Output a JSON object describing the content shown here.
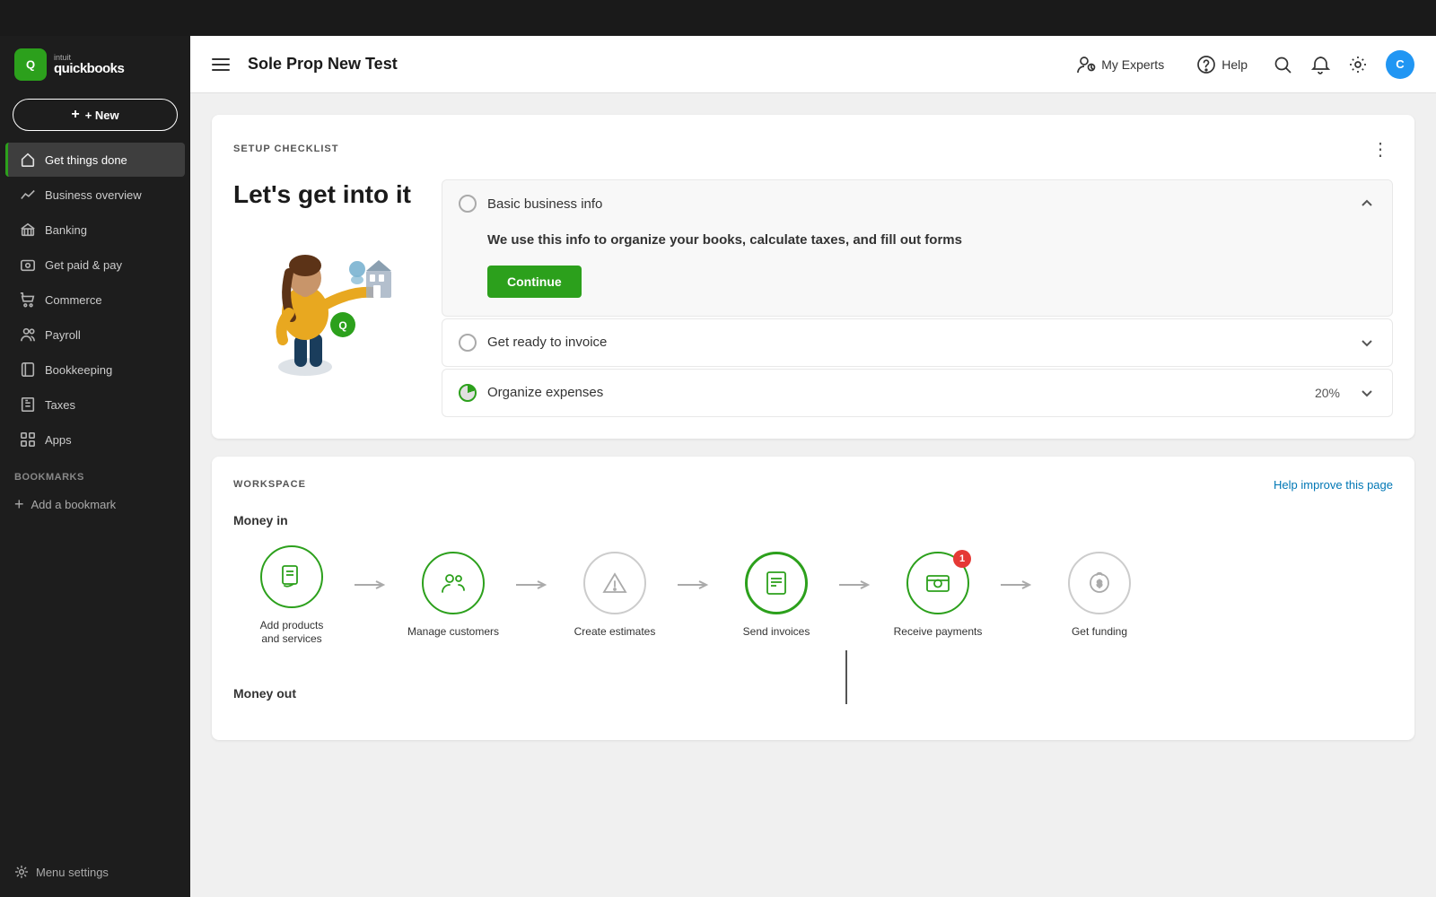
{
  "topBar": {
    "visible": true
  },
  "sidebar": {
    "logo": {
      "text1": "intuit",
      "text2": "quickbooks"
    },
    "newButton": {
      "label": "+ New"
    },
    "navItems": [
      {
        "id": "get-things-done",
        "label": "Get things done",
        "icon": "home",
        "active": true
      },
      {
        "id": "business-overview",
        "label": "Business overview",
        "icon": "chart"
      },
      {
        "id": "banking",
        "label": "Banking",
        "icon": "bank"
      },
      {
        "id": "get-paid-pay",
        "label": "Get paid & pay",
        "icon": "dollar"
      },
      {
        "id": "commerce",
        "label": "Commerce",
        "icon": "shop"
      },
      {
        "id": "payroll",
        "label": "Payroll",
        "icon": "people"
      },
      {
        "id": "bookkeeping",
        "label": "Bookkeeping",
        "icon": "book"
      },
      {
        "id": "taxes",
        "label": "Taxes",
        "icon": "tax"
      },
      {
        "id": "apps",
        "label": "Apps",
        "icon": "apps"
      }
    ],
    "bookmarks": {
      "label": "BOOKMARKS",
      "addLabel": "Add a bookmark"
    },
    "footer": {
      "menuSettingsLabel": "Menu settings"
    }
  },
  "header": {
    "title": "Sole Prop New Test",
    "myExpertsLabel": "My Experts",
    "helpLabel": "Help",
    "userInitial": "C"
  },
  "setupChecklist": {
    "sectionLabel": "SETUP CHECKLIST",
    "mainTitle": "Let's get into it",
    "items": [
      {
        "id": "basic-business-info",
        "label": "Basic business info",
        "expanded": true,
        "description": "We use this info to organize your books, calculate taxes, and fill out forms",
        "continueLabel": "Continue"
      },
      {
        "id": "get-ready-invoice",
        "label": "Get ready to invoice",
        "expanded": false
      },
      {
        "id": "organize-expenses",
        "label": "Organize expenses",
        "expanded": false,
        "percent": "20%",
        "partial": true
      }
    ]
  },
  "workspace": {
    "sectionLabel": "WORKSPACE",
    "helpLink": "Help improve this page",
    "moneyIn": {
      "label": "Money in",
      "items": [
        {
          "id": "add-products",
          "label": "Add products\nand services",
          "icon": "receipt-hand",
          "active": true
        },
        {
          "id": "manage-customers",
          "label": "Manage customers",
          "icon": "people-circle",
          "active": true
        },
        {
          "id": "create-estimates",
          "label": "Create estimates",
          "icon": "triangle-warning",
          "active": false
        },
        {
          "id": "send-invoices",
          "label": "Send invoices",
          "icon": "invoice",
          "active": true,
          "badge": null
        },
        {
          "id": "receive-payments",
          "label": "Receive payments",
          "icon": "payment",
          "active": true,
          "badge": "1"
        },
        {
          "id": "get-funding",
          "label": "Get funding",
          "icon": "money-bag",
          "active": false
        }
      ]
    },
    "moneyOut": {
      "label": "Money out"
    }
  }
}
